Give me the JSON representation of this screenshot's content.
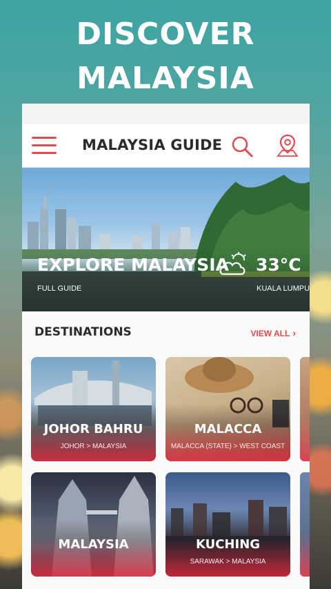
{
  "promo": {
    "headline_line1": "DISCOVER",
    "headline_line2": "MALAYSIA"
  },
  "appbar": {
    "title": "MALAYSIA GUIDE",
    "menu_icon": "hamburger-menu-icon",
    "search_icon": "search-icon",
    "map_icon": "map-pin-icon"
  },
  "hero": {
    "title": "EXPLORE MALAYSIA",
    "subtitle": "FULL GUIDE",
    "temperature": "33°C",
    "city": "KUALA LUMPUR",
    "weather_icon": "cloudy-sun-icon"
  },
  "destinations": {
    "heading": "DESTINATIONS",
    "view_all": "VIEW ALL",
    "cards": [
      {
        "title": "JOHOR BAHRU",
        "subtitle": "JOHOR > MALAYSIA"
      },
      {
        "title": "MALACCA",
        "subtitle": "MALACCA (STATE) > WEST COAST"
      },
      {
        "title": "MALAYSIA",
        "subtitle": ""
      },
      {
        "title": "KUCHING",
        "subtitle": "SARAWAK > MALAYSIA"
      }
    ]
  },
  "colors": {
    "accent": "#e5484d",
    "title_text": "#2b2b2b"
  }
}
